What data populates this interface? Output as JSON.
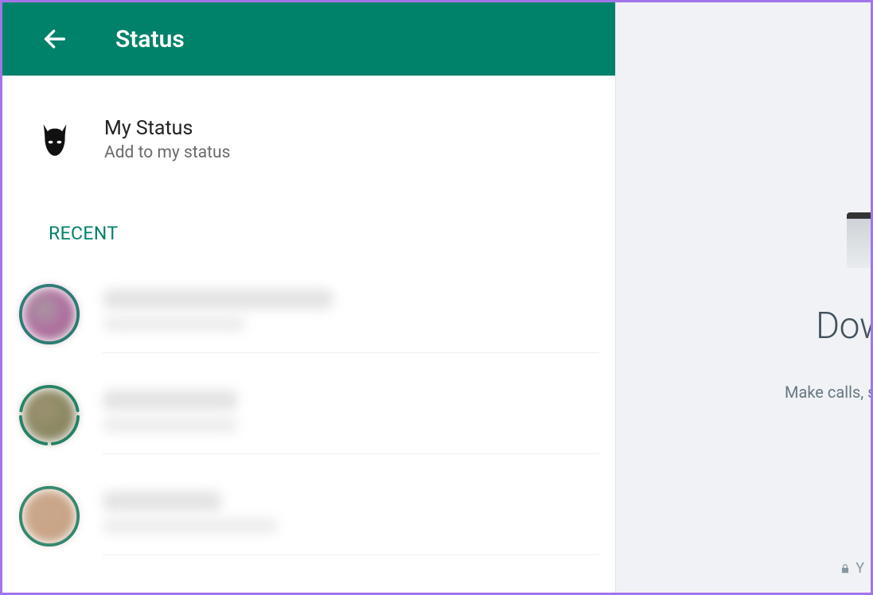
{
  "colors": {
    "brand": "#00816a",
    "accent": "#008069",
    "frame": "#a175e8"
  },
  "header": {
    "title": "Status"
  },
  "my_status": {
    "title": "My Status",
    "subtitle": "Add to my status"
  },
  "sections": {
    "recent_label": "RECENT"
  },
  "status_items": [
    {
      "ring": "full",
      "avatar_gradient": [
        "#a99aa2",
        "#b06aa0",
        "#7f8270"
      ],
      "name_w": 290,
      "sub_w": 180
    },
    {
      "ring": "segmented",
      "avatar_gradient": [
        "#9e9272",
        "#8a8862",
        "#857b5e"
      ],
      "name_w": 170,
      "sub_w": 170
    },
    {
      "ring": "full",
      "avatar_gradient": [
        "#c9a88d",
        "#caa486",
        "#b19179"
      ],
      "name_w": 150,
      "sub_w": 220
    }
  ],
  "right": {
    "promo_title": "Downlo",
    "promo_sub": "Make calls, share y",
    "encrypt_tail": "Y"
  }
}
